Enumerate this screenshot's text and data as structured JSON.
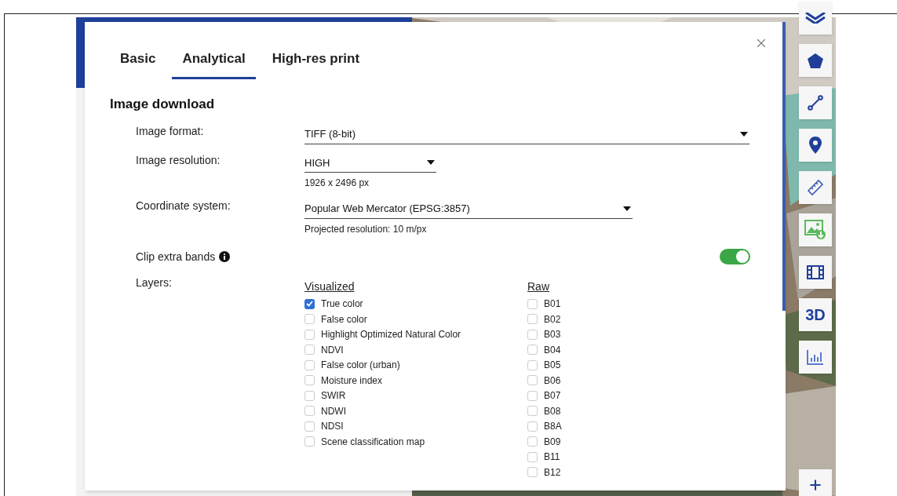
{
  "tabs": [
    {
      "label": "Basic",
      "selected": false
    },
    {
      "label": "Analytical",
      "selected": true
    },
    {
      "label": "High-res print",
      "selected": false
    }
  ],
  "section_title": "Image download",
  "fields": [
    {
      "label": "Image format:",
      "value": "TIFF (8-bit)"
    },
    {
      "label": "Image resolution:",
      "value": "HIGH",
      "note": "1926 x 2496 px"
    },
    {
      "label": "Coordinate system:",
      "value": "Popular Web Mercator (EPSG:3857)",
      "note": "Projected resolution: 10 m/px"
    }
  ],
  "clip_extra_bands": {
    "label": "Clip extra bands",
    "on": true
  },
  "layers": {
    "label": "Layers:",
    "columns": [
      {
        "heading": "Visualized",
        "items": [
          {
            "label": "True color",
            "checked": true
          },
          {
            "label": "False color",
            "checked": false
          },
          {
            "label": "Highlight Optimized Natural Color",
            "checked": false
          },
          {
            "label": "NDVI",
            "checked": false
          },
          {
            "label": "False color (urban)",
            "checked": false
          },
          {
            "label": "Moisture index",
            "checked": false
          },
          {
            "label": "SWIR",
            "checked": false
          },
          {
            "label": "NDWI",
            "checked": false
          },
          {
            "label": "NDSI",
            "checked": false
          },
          {
            "label": "Scene classification map",
            "checked": false
          }
        ]
      },
      {
        "heading": "Raw",
        "items": [
          {
            "label": "B01",
            "checked": false
          },
          {
            "label": "B02",
            "checked": false
          },
          {
            "label": "B03",
            "checked": false
          },
          {
            "label": "B04",
            "checked": false
          },
          {
            "label": "B05",
            "checked": false
          },
          {
            "label": "B06",
            "checked": false
          },
          {
            "label": "B07",
            "checked": false
          },
          {
            "label": "B08",
            "checked": false
          },
          {
            "label": "B8A",
            "checked": false
          },
          {
            "label": "B09",
            "checked": false
          },
          {
            "label": "B11",
            "checked": false
          },
          {
            "label": "B12",
            "checked": false
          }
        ]
      }
    ]
  },
  "toolbar": [
    {
      "kind": "layers"
    },
    {
      "kind": "polygon"
    },
    {
      "kind": "line"
    },
    {
      "kind": "pin"
    },
    {
      "kind": "ruler"
    },
    {
      "kind": "image-download"
    },
    {
      "kind": "film"
    },
    {
      "kind": "text",
      "label": "3D"
    },
    {
      "kind": "chart"
    }
  ],
  "zoom_controls": [
    {
      "kind": "plus"
    }
  ]
}
